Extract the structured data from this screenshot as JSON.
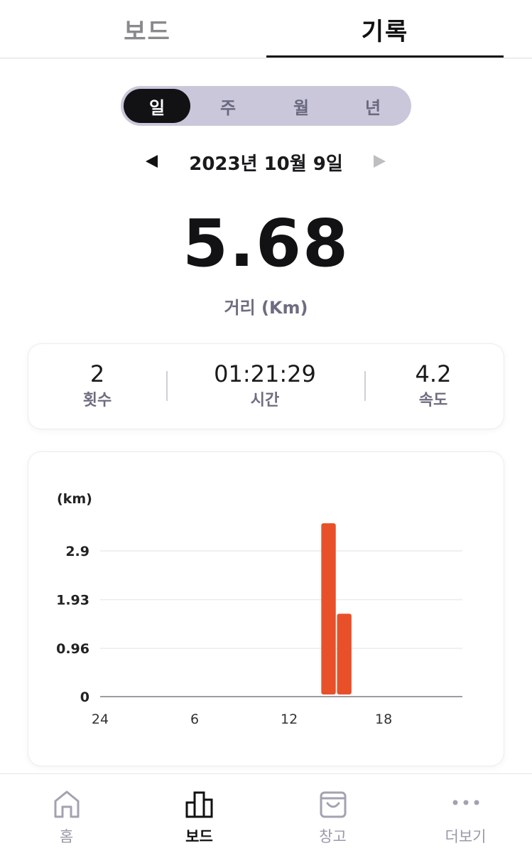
{
  "top_tabs": {
    "board": "보드",
    "record": "기록"
  },
  "period_tabs": [
    "일",
    "주",
    "월",
    "년"
  ],
  "date_nav": {
    "date": "2023년 10월 9일"
  },
  "distance": {
    "value": "5.68",
    "label": "거리 (Km)"
  },
  "stats": [
    {
      "value": "2",
      "label": "횟수"
    },
    {
      "value": "01:21:29",
      "label": "시간"
    },
    {
      "value": "4.2",
      "label": "속도"
    }
  ],
  "chart_data": {
    "type": "bar",
    "ylabel": "(km)",
    "y_ticks": [
      0,
      0.96,
      1.93,
      2.9
    ],
    "y_tick_labels": [
      "0",
      "0.96",
      "1.93",
      "2.9"
    ],
    "x_ticks": [
      0,
      6,
      12,
      18
    ],
    "x_tick_labels": [
      "24",
      "6",
      "12",
      "18"
    ],
    "xlim": [
      0,
      23
    ],
    "ylim": [
      0,
      2.9
    ],
    "hours": [
      14.5,
      15.5
    ],
    "values": [
      3.45,
      1.65
    ],
    "bar_color": "#e8502a",
    "grid": true
  },
  "bottom_nav": [
    {
      "label": "홈",
      "icon": "home-icon"
    },
    {
      "label": "보드",
      "icon": "bar-chart-icon"
    },
    {
      "label": "창고",
      "icon": "storage-bag-icon"
    },
    {
      "label": "더보기",
      "icon": "more-dots-icon"
    }
  ],
  "colors": {
    "accent_bar": "#e8502a",
    "active_tab": "#121215",
    "segment_bg": "#c9c7d9",
    "muted_text": "#6e6c80"
  }
}
